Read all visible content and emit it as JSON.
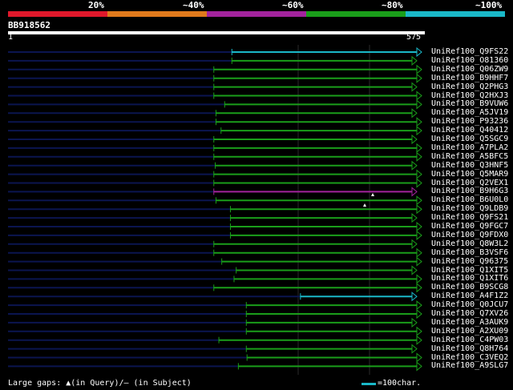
{
  "identity_scale": {
    "labels": [
      "20%",
      "~40%",
      "~60%",
      "~80%",
      "~100%"
    ],
    "colors": [
      "#e0182b",
      "#e07a1c",
      "#a3239d",
      "#1a9e1a",
      "#1ab8c8"
    ]
  },
  "query": {
    "id": "BB918562",
    "length": 575,
    "start_label": "1",
    "end_label": "575"
  },
  "colors": {
    "line": "#1a9e1a",
    "dark_line": "#0b1550",
    "grid": "#2a2a2a",
    "cyan": "#1ab8c8",
    "purple": "#a3239d"
  },
  "hits": [
    {
      "name": "UniRef100_Q9FS22",
      "start": 310,
      "color": "cyan"
    },
    {
      "name": "UniRef100_O81360",
      "start": 310,
      "color": "green"
    },
    {
      "name": "UniRef100_Q06ZW9",
      "start": 285,
      "color": "green"
    },
    {
      "name": "UniRef100_B9HHF7",
      "start": 285,
      "color": "green"
    },
    {
      "name": "UniRef100_Q2PHG3",
      "start": 285,
      "color": "green"
    },
    {
      "name": "UniRef100_Q2HXJ3",
      "start": 285,
      "color": "green"
    },
    {
      "name": "UniRef100_B9VUW6",
      "start": 300,
      "color": "green"
    },
    {
      "name": "UniRef100_A5JV19",
      "start": 288,
      "color": "green"
    },
    {
      "name": "UniRef100_P93236",
      "start": 288,
      "color": "green"
    },
    {
      "name": "UniRef100_Q40412",
      "start": 295,
      "color": "green"
    },
    {
      "name": "UniRef100_Q5SGC9",
      "start": 285,
      "color": "green"
    },
    {
      "name": "UniRef100_A7PLA2",
      "start": 285,
      "color": "green"
    },
    {
      "name": "UniRef100_A5BFC5",
      "start": 285,
      "color": "green"
    },
    {
      "name": "UniRef100_Q3HNF5",
      "start": 287,
      "color": "green"
    },
    {
      "name": "UniRef100_Q5MAR9",
      "start": 285,
      "color": "green"
    },
    {
      "name": "UniRef100_Q2VEX1",
      "start": 285,
      "color": "green"
    },
    {
      "name": "UniRef100_B9H6G3",
      "start": 285,
      "color": "purple"
    },
    {
      "name": "UniRef100_B6U0L0",
      "start": 288,
      "color": "green"
    },
    {
      "name": "UniRef100_Q9LDB9",
      "start": 308,
      "color": "green"
    },
    {
      "name": "UniRef100_Q9FS21",
      "start": 308,
      "color": "green"
    },
    {
      "name": "UniRef100_Q9FGC7",
      "start": 308,
      "color": "green"
    },
    {
      "name": "UniRef100_Q9FDX0",
      "start": 308,
      "color": "green"
    },
    {
      "name": "UniRef100_Q8W3L2",
      "start": 285,
      "color": "green"
    },
    {
      "name": "UniRef100_B3VSF6",
      "start": 285,
      "color": "green"
    },
    {
      "name": "UniRef100_Q96375",
      "start": 296,
      "color": "green"
    },
    {
      "name": "UniRef100_Q1XIT5",
      "start": 316,
      "color": "green"
    },
    {
      "name": "UniRef100_Q1XIT6",
      "start": 313,
      "color": "green"
    },
    {
      "name": "UniRef100_B9SCG8",
      "start": 285,
      "color": "green"
    },
    {
      "name": "UniRef100_A4F1Z2",
      "start": 405,
      "color": "cyan"
    },
    {
      "name": "UniRef100_Q0JCU7",
      "start": 330,
      "color": "green"
    },
    {
      "name": "UniRef100_Q7XV26",
      "start": 330,
      "color": "green"
    },
    {
      "name": "UniRef100_A3AUK9",
      "start": 330,
      "color": "green"
    },
    {
      "name": "UniRef100_A2XU09",
      "start": 330,
      "color": "green"
    },
    {
      "name": "UniRef100_C4PW03",
      "start": 292,
      "color": "green"
    },
    {
      "name": "UniRef100_Q8H764",
      "start": 330,
      "color": "green"
    },
    {
      "name": "UniRef100_C3VEQ2",
      "start": 331,
      "color": "green"
    },
    {
      "name": "UniRef100_A9SLG7",
      "start": 319,
      "color": "green"
    }
  ],
  "footer": {
    "gaps_text": "Large gaps: ▲(in Query)/– (in Subject)",
    "legend_text": "=100char."
  }
}
